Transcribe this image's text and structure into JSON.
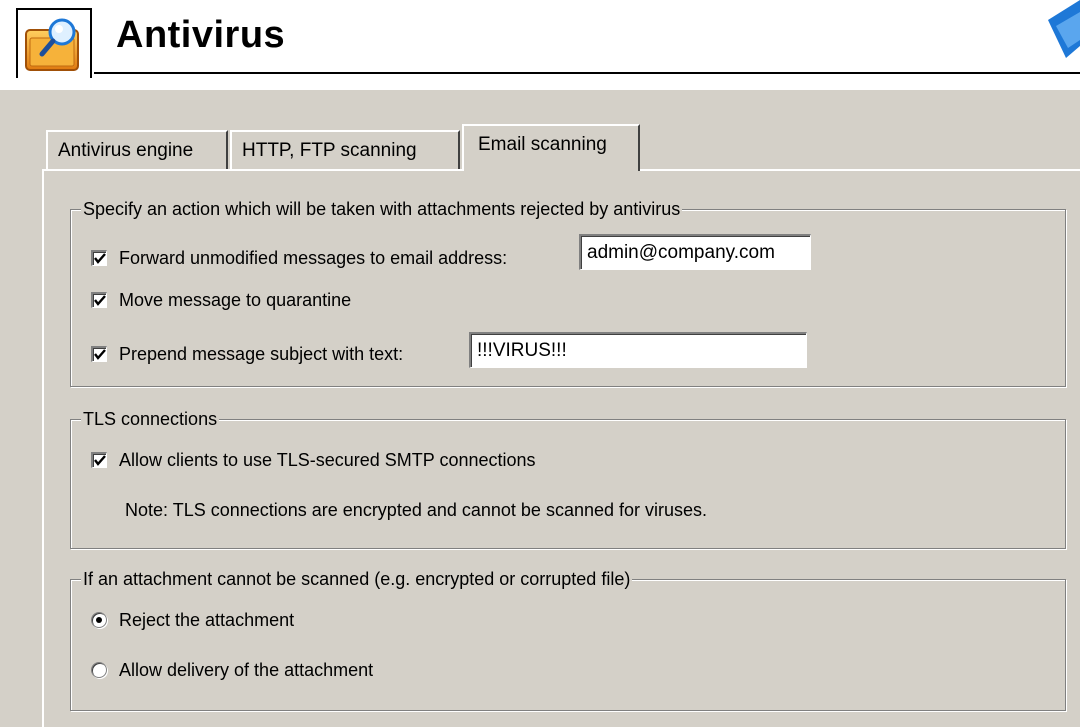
{
  "header": {
    "title": "Antivirus",
    "icon": "antivirus-magnifier-icon"
  },
  "tabs": [
    {
      "label": "Antivirus engine",
      "active": false
    },
    {
      "label": "HTTP, FTP scanning",
      "active": false
    },
    {
      "label": "Email scanning",
      "active": true
    }
  ],
  "attachments_group": {
    "legend": "Specify an action which will be taken with attachments rejected by antivirus",
    "forward": {
      "label": "Forward unmodified messages to email address:",
      "checked": true,
      "value": "admin@company.com"
    },
    "quarantine": {
      "label": "Move message to quarantine",
      "checked": true
    },
    "prepend": {
      "label": "Prepend message subject with text:",
      "checked": true,
      "value": "!!!VIRUS!!!"
    }
  },
  "tls_group": {
    "legend": "TLS connections",
    "allow": {
      "label": "Allow clients to use TLS-secured SMTP connections",
      "checked": true
    },
    "note": "Note: TLS connections are encrypted and cannot be scanned for viruses."
  },
  "unscannable_group": {
    "legend": "If an attachment cannot be scanned (e.g. encrypted or corrupted file)",
    "options": [
      {
        "label": "Reject the attachment",
        "selected": true
      },
      {
        "label": "Allow delivery of the attachment",
        "selected": false
      }
    ]
  },
  "colors": {
    "panel_bg": "#d4d0c8",
    "accent_blue": "#1e78d7",
    "icon_orange": "#f0a030"
  }
}
